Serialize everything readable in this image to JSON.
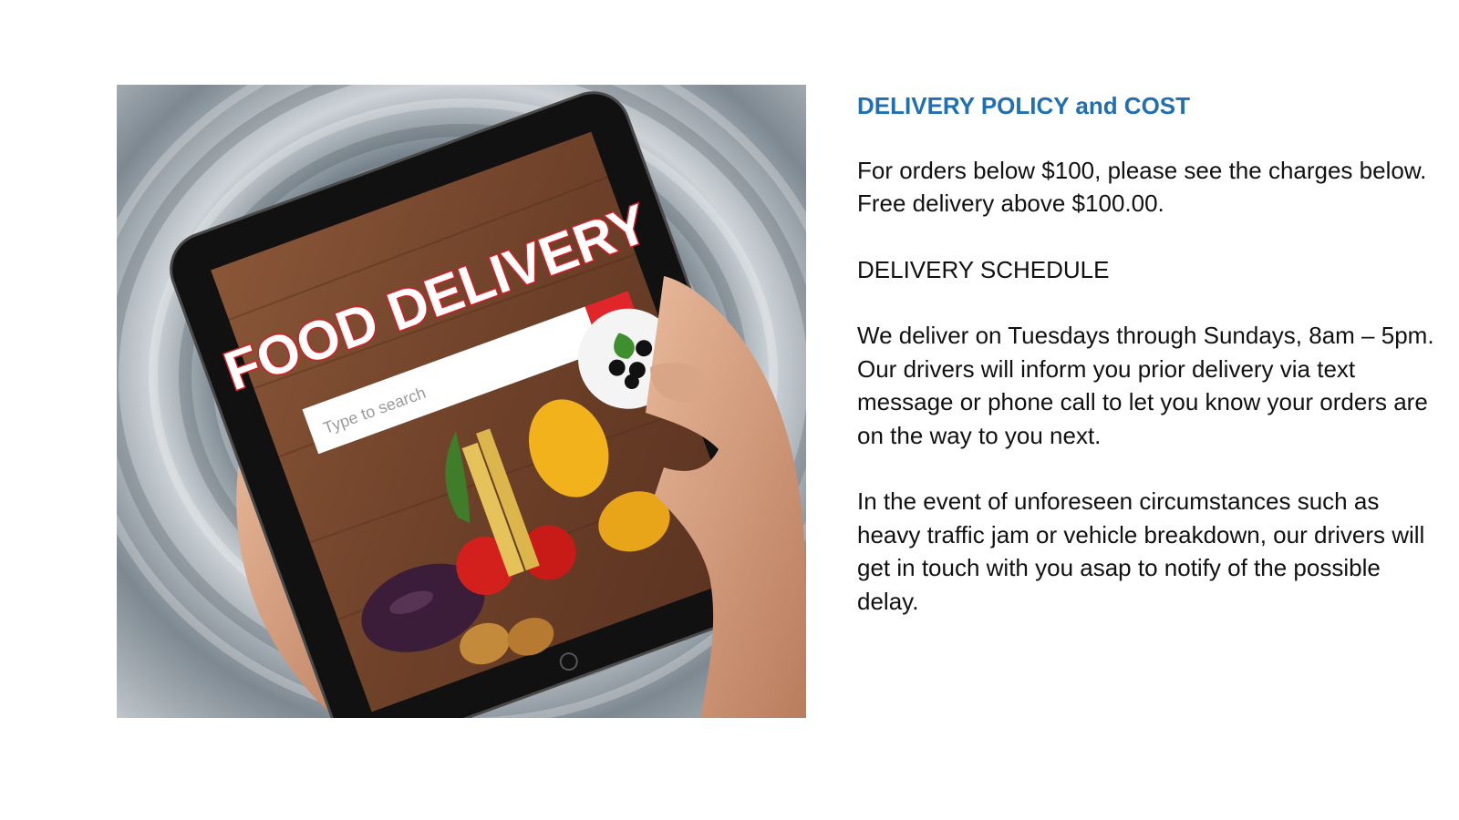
{
  "image": {
    "screen_title": "FOOD DELIVERY",
    "search_placeholder": "Type to search",
    "colors": {
      "tablet_frame": "#111111",
      "wood": "#7a4a33",
      "title_red": "#d21f26",
      "search_button": "#e0262b"
    }
  },
  "policy": {
    "heading": "DELIVERY POLICY and COST",
    "intro": "For orders below $100, please see the charges below. Free delivery above $100.00.",
    "schedule_heading": "DELIVERY SCHEDULE",
    "schedule_text": "We deliver on Tuesdays through Sundays, 8am – 5pm. Our drivers will inform you prior delivery via text message or phone call to let you know your orders are on the way to you next.",
    "delay_text": "In the event of unforeseen circumstances such as heavy traffic jam or vehicle breakdown, our drivers will get in touch with you asap to notify of the possible delay."
  },
  "colors": {
    "heading": "#1f6fb2",
    "body_text": "#111111"
  }
}
